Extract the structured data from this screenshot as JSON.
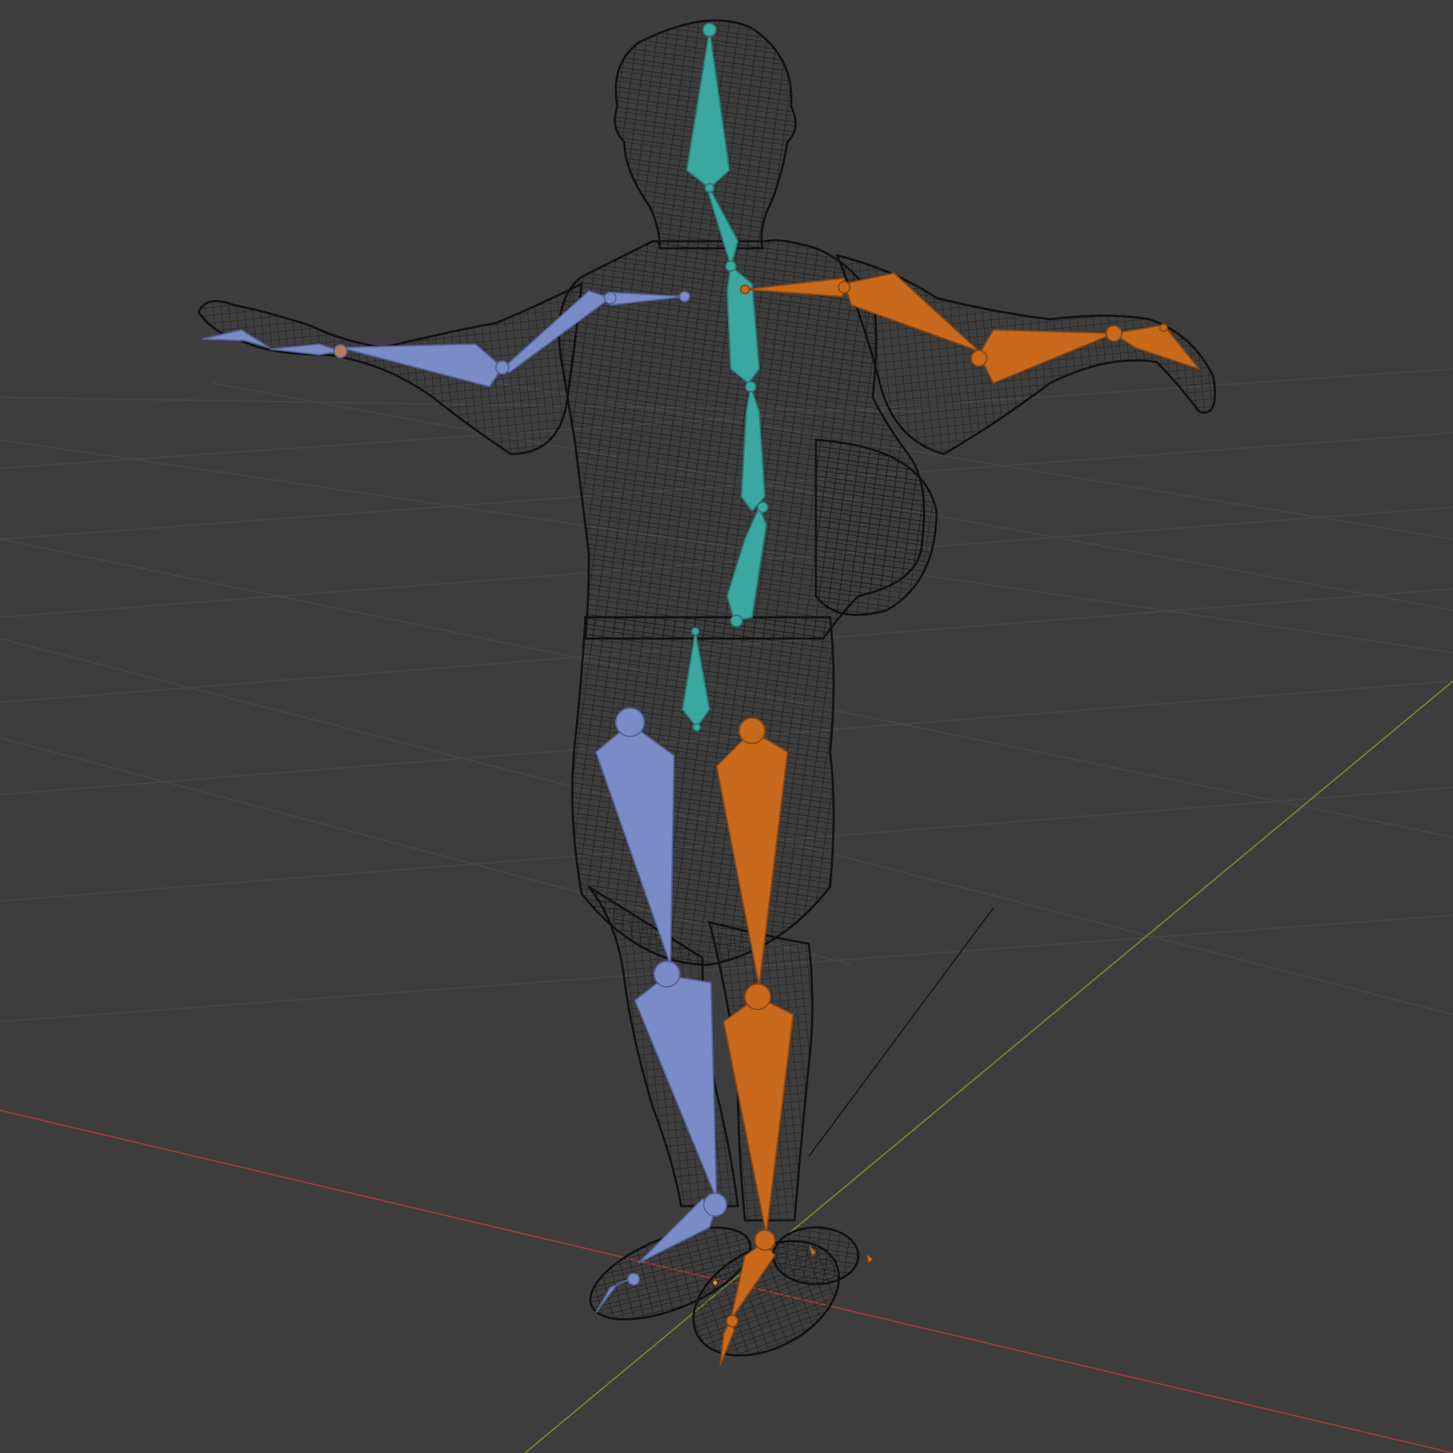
{
  "viewport": {
    "view_mode": "wireframe",
    "background_color": "#3d3d3d",
    "grid_color": "#4a4a4a",
    "axis_x_color": "#a23a3a",
    "axis_y_color": "#6f8a2a",
    "mesh_color": "#111111",
    "bone_colors": {
      "center": "#3aa7a0",
      "left": "#7a8cc8",
      "right": "#c8691c"
    }
  },
  "scene": {
    "objects": [
      {
        "name": "character-mesh",
        "type": "mesh",
        "display": "wireframe"
      },
      {
        "name": "armature",
        "type": "armature",
        "display": "octahedral"
      }
    ],
    "bone_groups": [
      "spine",
      "left-arm",
      "right-arm",
      "left-leg",
      "right-leg"
    ]
  }
}
